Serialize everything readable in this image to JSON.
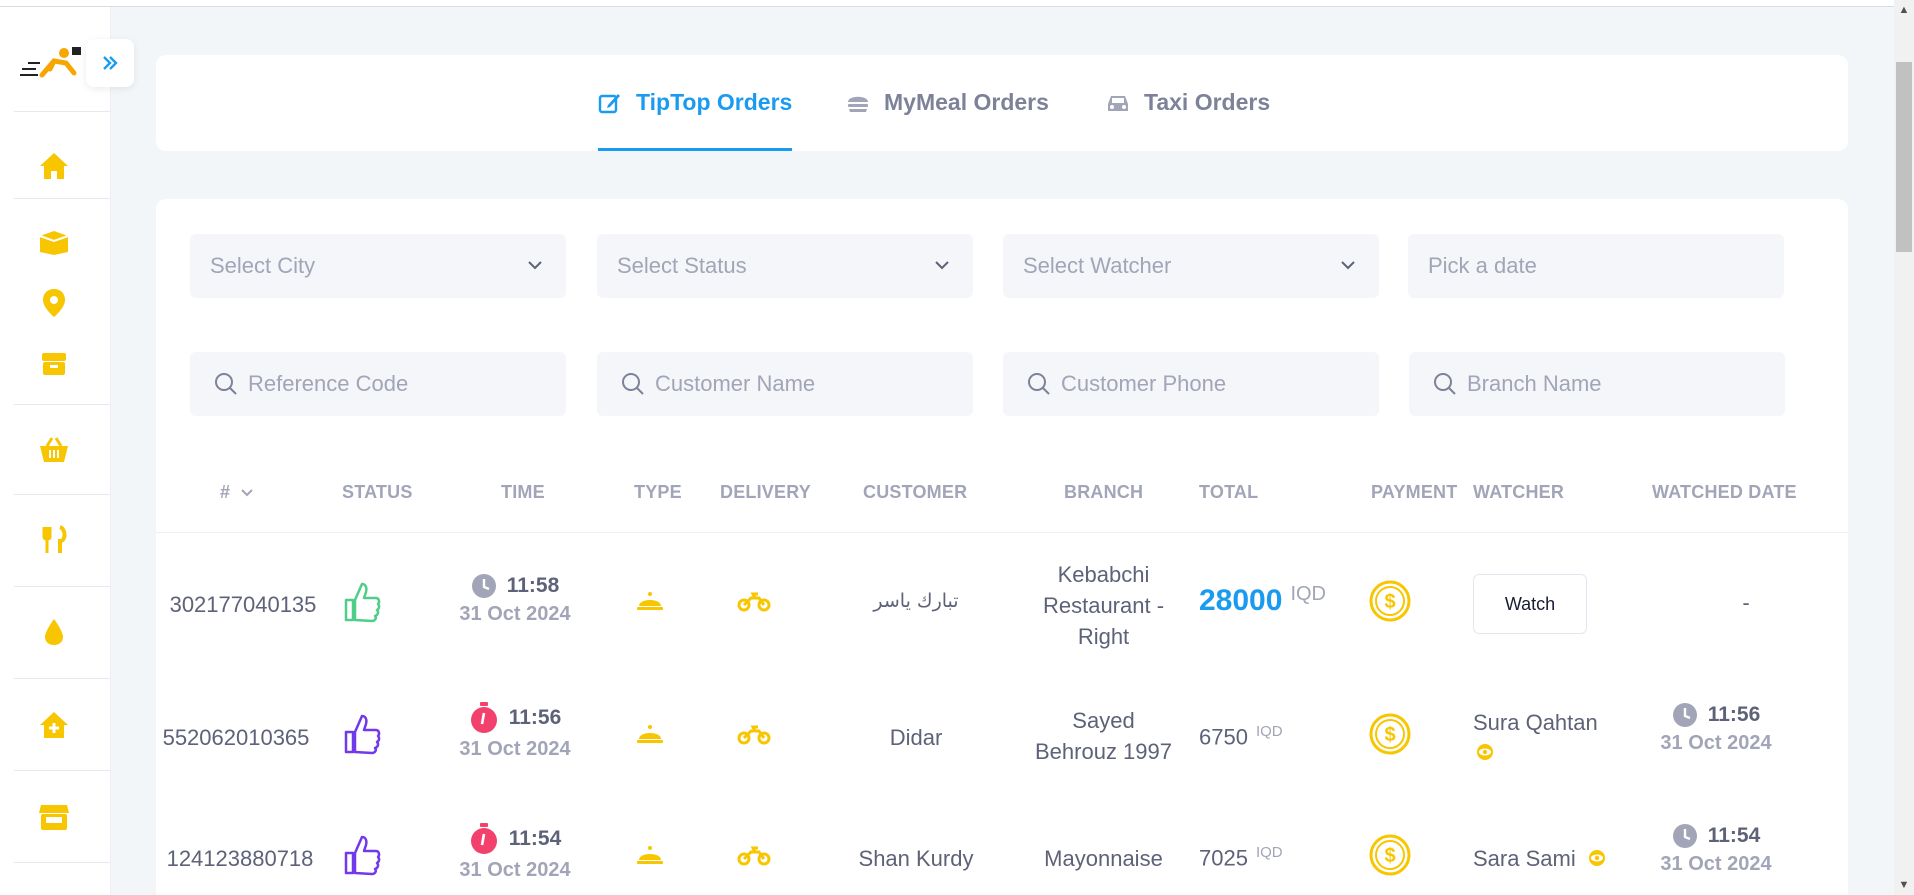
{
  "tabs": [
    {
      "label": "TipTop Orders",
      "icon": "edit-icon",
      "active": true
    },
    {
      "label": "MyMeal Orders",
      "icon": "burger-icon",
      "active": false
    },
    {
      "label": "Taxi Orders",
      "icon": "car-icon",
      "active": false
    }
  ],
  "filters": {
    "city": "Select City",
    "status": "Select Status",
    "watcher": "Select Watcher",
    "date": "Pick a date",
    "reference_placeholder": "Reference Code",
    "customer_placeholder": "Customer Name",
    "phone_placeholder": "Customer Phone",
    "branch_placeholder": "Branch Name"
  },
  "table": {
    "headers": {
      "id": "#",
      "status": "STATUS",
      "time": "TIME",
      "type": "TYPE",
      "delivery": "DELIVERY",
      "customer": "CUSTOMER",
      "branch": "BRANCH",
      "total": "TOTAL",
      "payment": "PAYMENT",
      "watcher": "WATCHER",
      "watched_date": "WATCHED DATE"
    },
    "rows": [
      {
        "id": "302177040135",
        "status_icon": "thumbs-up-green",
        "time": "11:58",
        "date": "31 Oct 2024",
        "customer": "تبارك ياسر",
        "branch_lines": [
          "Kebabchi",
          "Restaurant -",
          "Right"
        ],
        "total": "28000",
        "currency": "IQD",
        "watch_label": "Watch",
        "watched_date": "-"
      },
      {
        "id": "552062010365",
        "status_icon": "thumbs-up-purple",
        "time": "11:56",
        "date": "31 Oct 2024",
        "customer": "Didar",
        "branch_lines": [
          "Sayed",
          "Behrouz 1997"
        ],
        "total": "6750",
        "currency": "IQD",
        "watcher": "Sura Qahtan",
        "watched_time": "11:56",
        "watched_date": "31 Oct 2024"
      },
      {
        "id": "124123880718",
        "status_icon": "thumbs-up-purple",
        "time": "11:54",
        "date": "31 Oct 2024",
        "customer": "Shan Kurdy",
        "branch_lines": [
          "Mayonnaise"
        ],
        "total": "7025",
        "currency": "IQD",
        "watcher": "Sara Sami",
        "watched_time": "11:54",
        "watched_date": "31 Oct 2024"
      }
    ]
  },
  "colors": {
    "accent": "#1b9bf0",
    "icon_yellow": "#f7c600",
    "green": "#50cd89",
    "purple": "#7239ea",
    "red": "#f1416c"
  }
}
